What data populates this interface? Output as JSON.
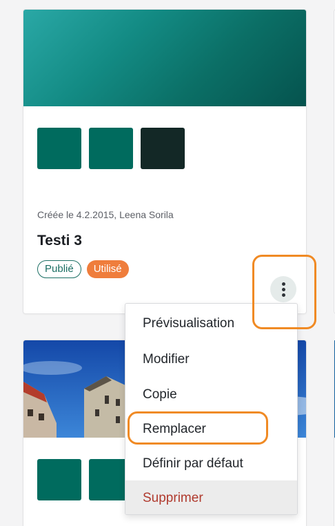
{
  "colors": {
    "accent": "#1b6e63",
    "used_badge": "#ef7d3c",
    "delete_text": "#b03a2e",
    "highlight": "#f08a24"
  },
  "cards": [
    {
      "swatches": [
        "#006b5e",
        "#006b5e",
        "#132826"
      ],
      "meta": "Créée le 4.2.2015, Leena Sorila",
      "title": "Testi 3",
      "badges": {
        "published": "Publié",
        "used": "Utilisé"
      },
      "more_icon": "vertical-dots-icon"
    },
    {
      "swatches": [
        "#006b5e",
        "#006b5e"
      ]
    }
  ],
  "menu": {
    "items": [
      "Prévisualisation",
      "Modifier",
      "Copie",
      "Remplacer",
      "Définir par défaut",
      "Supprimer"
    ]
  }
}
